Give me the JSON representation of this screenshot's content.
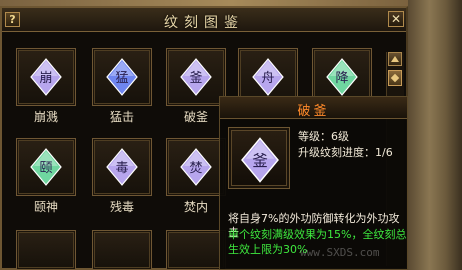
{
  "window": {
    "title": "纹刻图鉴",
    "help_label": "?",
    "close_label": "✕"
  },
  "grid": {
    "cells": [
      {
        "label": "崩溅",
        "glyph": "崩",
        "color": "purple"
      },
      {
        "label": "猛击",
        "glyph": "猛",
        "color": "blue"
      },
      {
        "label": "破釜",
        "glyph": "釜",
        "color": "purple"
      },
      {
        "label": "",
        "glyph": "舟",
        "color": "purple"
      },
      {
        "label": "",
        "glyph": "降",
        "color": "green"
      },
      {
        "label": "颐神",
        "glyph": "颐",
        "color": "green"
      },
      {
        "label": "残毒",
        "glyph": "毒",
        "color": "purple"
      },
      {
        "label": "焚内",
        "glyph": "焚",
        "color": "purple"
      }
    ]
  },
  "tooltip": {
    "title": "破釜",
    "glyph": "釜",
    "level": "等级：6级",
    "progress": "升级纹刻进度：1/6",
    "desc": "将自身7%的外功防御转化为外功攻击",
    "bonus": "单个纹刻满级效果为15%，全纹刻总生效上限为30%"
  },
  "watermark": "www.SXDS.com",
  "colors": {
    "purple": "#b7a6ee",
    "blue": "#6f86f0",
    "green": "#6fd6a0",
    "title_orange": "#ff8a2a",
    "bonus_green": "#3ee83e"
  }
}
